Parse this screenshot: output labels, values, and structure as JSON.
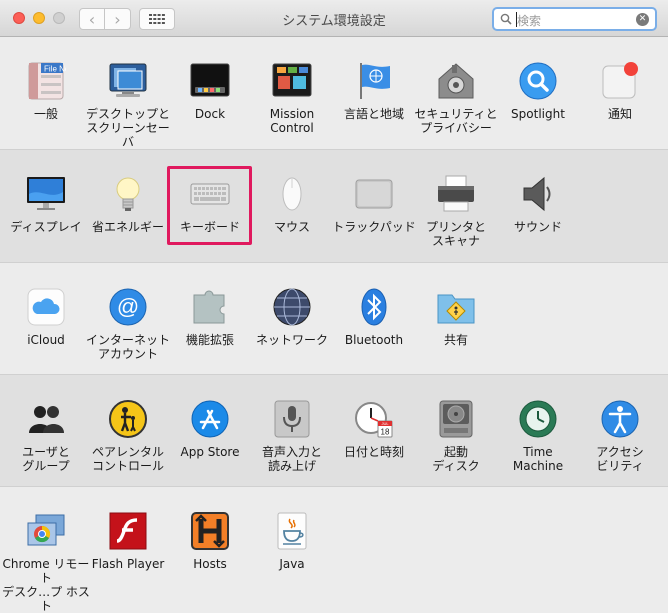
{
  "window": {
    "title": "システム環境設定"
  },
  "toolbar": {
    "back": "‹",
    "forward": "›"
  },
  "search": {
    "text": "検索",
    "clear": "✕"
  },
  "sections": [
    {
      "items": [
        {
          "label": "一般",
          "icon": "general-icon"
        },
        {
          "label": "デスクトップと\nスクリーンセーバ",
          "icon": "desktop-screensaver-icon"
        },
        {
          "label": "Dock",
          "icon": "dock-icon"
        },
        {
          "label": "Mission\nControl",
          "icon": "mission-control-icon"
        },
        {
          "label": "言語と地域",
          "icon": "language-region-icon"
        },
        {
          "label": "セキュリティと\nプライバシー",
          "icon": "security-privacy-icon"
        },
        {
          "label": "Spotlight",
          "icon": "spotlight-icon"
        },
        {
          "label": "通知",
          "icon": "notifications-icon"
        }
      ]
    },
    {
      "items": [
        {
          "label": "ディスプレイ",
          "icon": "display-icon"
        },
        {
          "label": "省エネルギー",
          "icon": "energy-saver-icon"
        },
        {
          "label": "キーボード",
          "icon": "keyboard-icon",
          "highlighted": true
        },
        {
          "label": "マウス",
          "icon": "mouse-icon"
        },
        {
          "label": "トラックパッド",
          "icon": "trackpad-icon"
        },
        {
          "label": "プリンタと\nスキャナ",
          "icon": "printer-scanner-icon"
        },
        {
          "label": "サウンド",
          "icon": "sound-icon"
        }
      ]
    },
    {
      "items": [
        {
          "label": "iCloud",
          "icon": "icloud-icon"
        },
        {
          "label": "インターネット\nアカウント",
          "icon": "internet-accounts-icon"
        },
        {
          "label": "機能拡張",
          "icon": "extensions-icon"
        },
        {
          "label": "ネットワーク",
          "icon": "network-icon"
        },
        {
          "label": "Bluetooth",
          "icon": "bluetooth-icon"
        },
        {
          "label": "共有",
          "icon": "sharing-icon"
        }
      ]
    },
    {
      "items": [
        {
          "label": "ユーザと\nグループ",
          "icon": "users-groups-icon"
        },
        {
          "label": "ペアレンタル\nコントロール",
          "icon": "parental-controls-icon"
        },
        {
          "label": "App Store",
          "icon": "app-store-icon"
        },
        {
          "label": "音声入力と\n読み上げ",
          "icon": "dictation-speech-icon"
        },
        {
          "label": "日付と時刻",
          "icon": "date-time-icon"
        },
        {
          "label": "起動\nディスク",
          "icon": "startup-disk-icon"
        },
        {
          "label": "Time\nMachine",
          "icon": "time-machine-icon"
        },
        {
          "label": "アクセシ\nビリティ",
          "icon": "accessibility-icon"
        }
      ]
    },
    {
      "items": [
        {
          "label": "Chrome リモート\nデスク…プ ホスト",
          "icon": "chrome-remote-desktop-icon"
        },
        {
          "label": "Flash Player",
          "icon": "flash-player-icon"
        },
        {
          "label": "Hosts",
          "icon": "hosts-icon"
        },
        {
          "label": "Java",
          "icon": "java-icon"
        }
      ]
    }
  ],
  "icon_text": {
    "general": "File\nNew\nOpe",
    "calendar_month": "JUL",
    "calendar_day": "18"
  },
  "colors": {
    "highlight": "#e0195e",
    "search_focus": "#7aaee8"
  }
}
